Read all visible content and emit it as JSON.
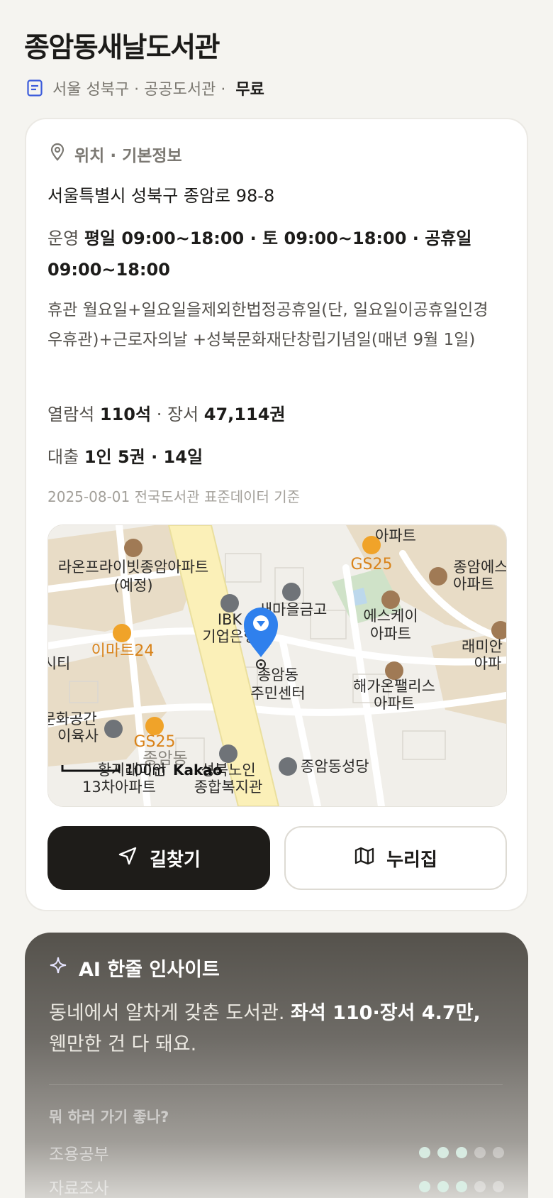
{
  "header": {
    "title": "종암동새날도서관",
    "meta": "서울 성북구 · 공공도서관 ·",
    "fee": "무료"
  },
  "info": {
    "section_title": "위치 · 기본정보",
    "address": "서울특별시 성북구 종암로 98-8",
    "hours_label": "운영",
    "hours_value": "평일 09:00~18:00 · 토 09:00~18:00 · 공휴일 09:00~18:00",
    "closed": "휴관 월요일+일요일을제외한법정공휴일(단, 일요일이공휴일인경우휴관)+근로자의날 +성북문화재단창립기념일(매년 9월 1일)",
    "seats_label": "열람석",
    "seats_value": "110석",
    "books_sep": "· 장서",
    "books_value": "47,114권",
    "loan_label": "대출",
    "loan_value": "1인 5권 · 14일",
    "source": "2025-08-01 전국도서관 표준데이터 기준"
  },
  "map": {
    "labels": {
      "apt_top": "아파트",
      "raon": "라온프라이빗종암아파트",
      "raon2": "(예정)",
      "gs25_top": "GS25",
      "jongam_es": "종암에스",
      "jongam_es2": "아파트",
      "sk": "에스케이",
      "sk2": "아파트",
      "raemian": "래미안",
      "raemian2": "아파",
      "ibk": "IBK",
      "ibk2": "기업은행",
      "saemaeul": "새마을금고",
      "emart": "이마트24",
      "city": "시티",
      "jumin": "종암동",
      "jumin2": "주민센터",
      "haegaon": "해가온팰리스",
      "haegaon2": "아파트",
      "culture": "문화공간",
      "culture2": "이육사",
      "gs25_bottom": "GS25",
      "jongam_bottom": "종암동",
      "hwangji": "황지래미안",
      "hwangji2": "13차아파트",
      "senior": "성북노인",
      "senior2": "종합복지관",
      "church": "종암동성당",
      "scale": "100m",
      "brand": "Kakao"
    },
    "accent": "#2f80ed"
  },
  "actions": {
    "directions": "길찾기",
    "website": "누리집"
  },
  "ai": {
    "title": "AI 한줄 인사이트",
    "text_plain": "동네에서 알차게 갖춘 도서관.",
    "text_bold": "좌석 110·장서 4.7만,",
    "text_tail": "웬만한 건 다 돼요.",
    "question": "뭐 하러 가기 좋나?",
    "items": [
      {
        "label": "조용공부",
        "level": 3
      },
      {
        "label": "자료조사",
        "level": 3
      }
    ]
  }
}
